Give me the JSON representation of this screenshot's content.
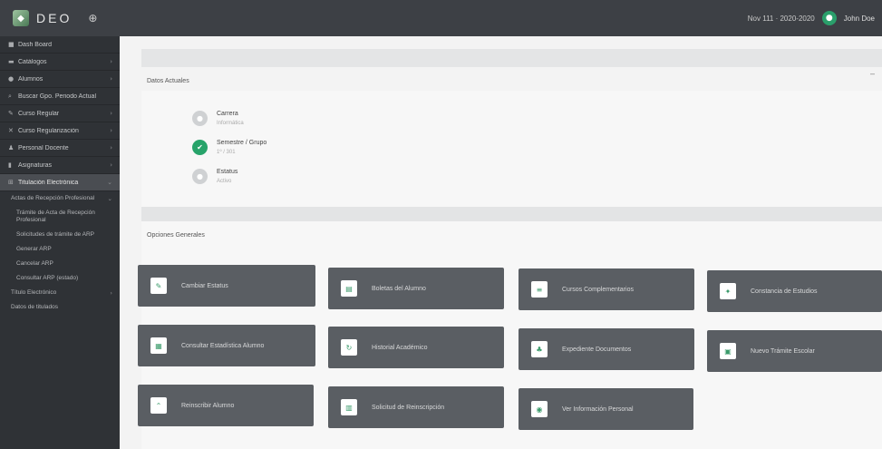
{
  "topbar": {
    "brand": "DEO",
    "period": "Nov 111 · 2020-2020",
    "user": "John Doe"
  },
  "sidebar": {
    "items": [
      {
        "label": "Dash Board",
        "icon": "dashboard-icon",
        "has_children": false
      },
      {
        "label": "Catálogos",
        "icon": "catalog-icon",
        "has_children": true
      },
      {
        "label": "Alumnos",
        "icon": "students-icon",
        "has_children": true
      },
      {
        "label": "Buscar Gpo. Periodo Actual",
        "icon": "search-icon",
        "has_children": false
      },
      {
        "label": "Curso Regular",
        "icon": "course-icon",
        "has_children": true
      },
      {
        "label": "Curso Regularización",
        "icon": "course-reg-icon",
        "has_children": true
      },
      {
        "label": "Personal Docente",
        "icon": "teacher-icon",
        "has_children": true
      },
      {
        "label": "Asignaturas",
        "icon": "subjects-icon",
        "has_children": true
      },
      {
        "label": "Titulación Electrónica",
        "icon": "degree-icon",
        "has_children": true,
        "active": true
      }
    ],
    "sub_items": [
      {
        "label": "Actas de Recepción Profesional",
        "level": 1,
        "has_children": true
      },
      {
        "label": "Trámite de Acta de Recepción Profesional",
        "level": 2
      },
      {
        "label": "Solicitudes de trámite de ARP",
        "level": 2
      },
      {
        "label": "Generar ARP",
        "level": 2
      },
      {
        "label": "Cancelar ARP",
        "level": 2
      },
      {
        "label": "Consultar ARP (estado)",
        "level": 2
      },
      {
        "label": "Título Electrónico",
        "level": 1,
        "has_children": true
      },
      {
        "label": "Datos de titulados",
        "level": 1
      }
    ]
  },
  "current_data": {
    "title": "Datos Actuales",
    "rows": [
      {
        "label": "Carrera",
        "value": "Informática",
        "status": "gray"
      },
      {
        "label": "Semestre / Grupo",
        "value": "1º / 301",
        "status": "green"
      },
      {
        "label": "Estatus",
        "value": "Activo",
        "status": "gray"
      }
    ]
  },
  "options": {
    "title": "Opciones Generales",
    "buttons": [
      {
        "label": "Cambiar Estatus",
        "icon": "edit-icon"
      },
      {
        "label": "Boletas del Alumno",
        "icon": "document-icon"
      },
      {
        "label": "Cursos Complementarios",
        "icon": "courses-icon"
      },
      {
        "label": "Constancia de Estudios",
        "icon": "certificate-icon"
      },
      {
        "label": "Consultar Estadística Alumno",
        "icon": "chart-icon"
      },
      {
        "label": "Historial Académico",
        "icon": "history-icon"
      },
      {
        "label": "Expediente Documentos",
        "icon": "folder-icon"
      },
      {
        "label": "Nuevo Trámite Escolar",
        "icon": "new-procedure-icon"
      },
      {
        "label": "Reinscribir Alumno",
        "icon": "reenroll-icon"
      },
      {
        "label": "Solicitud de Reinscripción",
        "icon": "request-icon"
      },
      {
        "label": "Ver Información Personal",
        "icon": "info-icon"
      }
    ]
  }
}
